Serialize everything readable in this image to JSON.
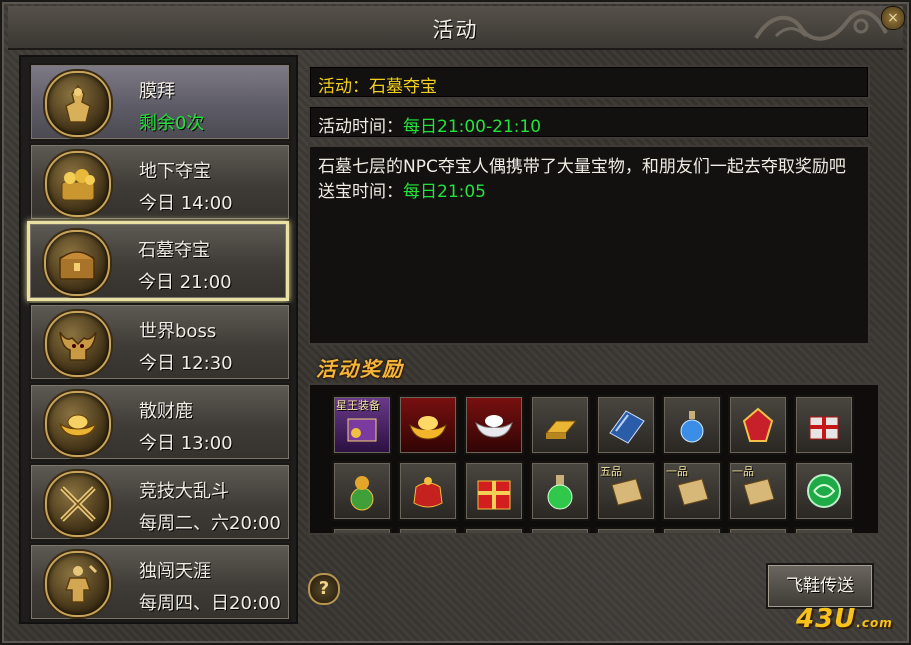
{
  "window": {
    "title": "活动"
  },
  "activities": [
    {
      "name": "膜拜",
      "time": "剩余0次",
      "icon": "warrior-statue-icon"
    },
    {
      "name": "地下夺宝",
      "time": "今日 14:00",
      "icon": "treasure-pile-icon"
    },
    {
      "name": "石墓夺宝",
      "time": "今日 21:00",
      "icon": "treasure-chest-icon"
    },
    {
      "name": "世界boss",
      "time": "今日 12:30",
      "icon": "bull-demon-icon"
    },
    {
      "name": "散财鹿",
      "time": "今日 13:00",
      "icon": "gold-ingot-icon"
    },
    {
      "name": "竞技大乱斗",
      "time": "每周二、六20:00",
      "icon": "crossed-swords-icon"
    },
    {
      "name": "独闯天涯",
      "time": "每周四、日20:00",
      "icon": "warrior-figure-icon"
    }
  ],
  "detail": {
    "activity_label": "活动：",
    "activity_name": "石墓夺宝",
    "time_label": "活动时间：",
    "time_value": "每日21:00-21:10",
    "description": "石墓七层的NPC夺宝人偶携带了大量宝物，和朋友们一起去夺取奖励吧",
    "delivery_label": "送宝时间：",
    "delivery_value": "每日21:05"
  },
  "rewards": {
    "title": "活动奖励",
    "items": [
      {
        "icon": "equipment-box-icon",
        "tag": "星王装备"
      },
      {
        "icon": "gold-ingot-red-icon",
        "tag": ""
      },
      {
        "icon": "silver-ingot-icon",
        "tag": ""
      },
      {
        "icon": "gold-bar-icon",
        "tag": ""
      },
      {
        "icon": "blue-book-icon",
        "tag": ""
      },
      {
        "icon": "blue-potion-icon",
        "tag": ""
      },
      {
        "icon": "red-gem-icon",
        "tag": ""
      },
      {
        "icon": "gift-bundle-icon",
        "tag": ""
      },
      {
        "icon": "gourd-bag-icon",
        "tag": ""
      },
      {
        "icon": "red-pouch-icon",
        "tag": ""
      },
      {
        "icon": "red-gift-box-icon",
        "tag": ""
      },
      {
        "icon": "green-potion-icon",
        "tag": ""
      },
      {
        "icon": "scroll-icon",
        "tag": "五品"
      },
      {
        "icon": "scroll-icon",
        "tag": "一品"
      },
      {
        "icon": "scroll-icon",
        "tag": "一品"
      },
      {
        "icon": "jade-dragon-icon",
        "tag": ""
      }
    ]
  },
  "buttons": {
    "help": "?",
    "fly": "飞鞋传送"
  },
  "watermark": {
    "main": "43U",
    "suffix": ".com"
  },
  "colors": {
    "accent_yellow": "#f3d01e",
    "accent_green": "#23e23a",
    "selected_border": "#e9e1a3"
  }
}
